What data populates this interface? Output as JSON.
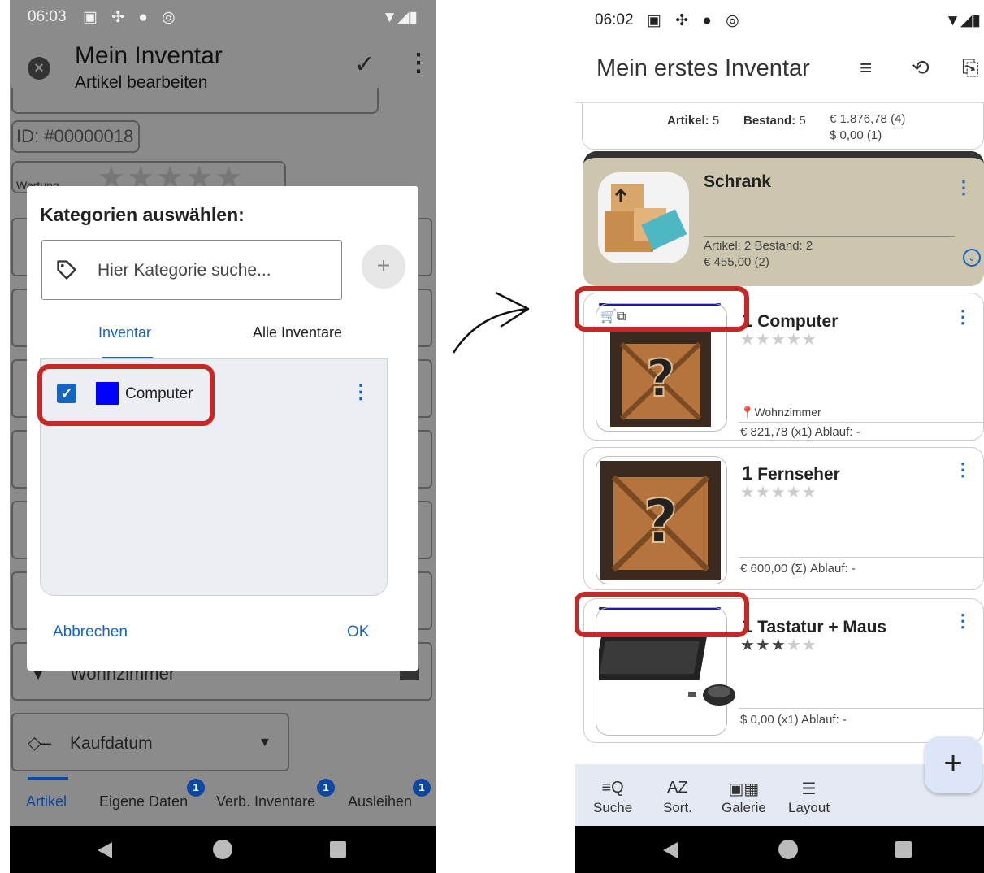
{
  "left": {
    "status_time": "06:03",
    "title": "Mein Inventar",
    "subtitle": "Artikel bearbeiten",
    "id_chip": "ID: #00000018",
    "rating_label": "Wertung",
    "dialog": {
      "title": "Kategorien auswählen:",
      "search_placeholder": "Hier Kategorie suche...",
      "tabs": [
        "Inventar",
        "Alle Inventare"
      ],
      "category": {
        "name": "Computer",
        "color": "#0000ff",
        "checked": true
      },
      "cancel_label": "Abbrechen",
      "ok_label": "OK"
    },
    "location_field": "Wohnzimmer",
    "purchase_date_field": "Kaufdatum",
    "tabs": [
      {
        "label": "Artikel",
        "badge": ""
      },
      {
        "label": "Eigene Daten",
        "badge": "1"
      },
      {
        "label": "Verb. Inventare",
        "badge": "1"
      },
      {
        "label": "Ausleihen",
        "badge": "1"
      }
    ]
  },
  "right": {
    "status_time": "06:02",
    "title": "Mein erstes Inventar",
    "summary": {
      "artikel_label": "Artikel:",
      "artikel_value": "5",
      "bestand_label": "Bestand:",
      "bestand_value": "5",
      "eur_value": "€ 1.876,78 (4)",
      "usd_value": "$ 0,00 (1)"
    },
    "group": {
      "title": "Schrank",
      "stats": "Artikel:  2   Bestand:  2",
      "value": "€ 455,00 (2)"
    },
    "items": [
      {
        "qty": "1",
        "name": "Computer",
        "stars": 0,
        "location": "Wohnzimmer",
        "price_line": "€ 821,78 (x1)   Ablauf: -"
      },
      {
        "qty": "1",
        "name": "Fernseher",
        "stars": 0,
        "location": "",
        "price_line": "€ 600,00 (Σ)   Ablauf: -"
      },
      {
        "qty": "1",
        "name": "Tastatur + Maus",
        "stars": 3,
        "location": "",
        "price_line": "$ 0,00 (x1)   Ablauf: -"
      }
    ],
    "bottom_nav": [
      "Suche",
      "Sort.",
      "Galerie",
      "Layout"
    ],
    "accent": "#1565c0",
    "highlight_color": "#c62828"
  }
}
